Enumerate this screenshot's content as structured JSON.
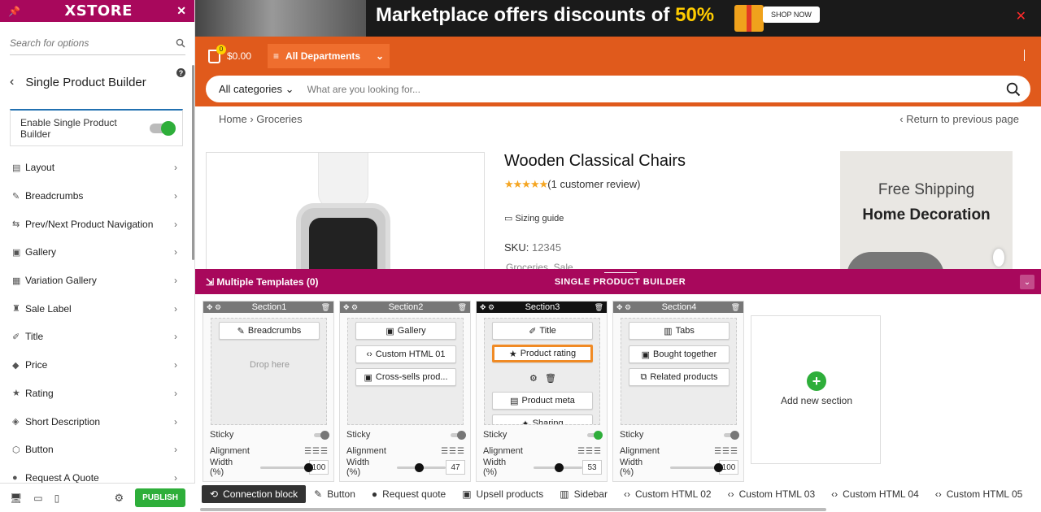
{
  "panel": {
    "logo": "XSTORE",
    "search_placeholder": "Search for options",
    "section_title": "Single Product Builder",
    "enable_label": "Enable Single Product Builder",
    "items": [
      {
        "label": "Layout",
        "icon": "layout-icon"
      },
      {
        "label": "Breadcrumbs",
        "icon": "breadcrumbs-icon"
      },
      {
        "label": "Prev/Next Product Navigation",
        "icon": "navigation-icon"
      },
      {
        "label": "Gallery",
        "icon": "gallery-icon"
      },
      {
        "label": "Variation Gallery",
        "icon": "variation-gallery-icon"
      },
      {
        "label": "Sale Label",
        "icon": "sale-label-icon"
      },
      {
        "label": "Title",
        "icon": "title-icon"
      },
      {
        "label": "Price",
        "icon": "price-icon"
      },
      {
        "label": "Rating",
        "icon": "star-icon"
      },
      {
        "label": "Short Description",
        "icon": "description-icon"
      },
      {
        "label": "Button",
        "icon": "button-icon"
      },
      {
        "label": "Request A Quote",
        "icon": "quote-icon"
      }
    ],
    "publish_label": "PUBLISH"
  },
  "site": {
    "banner_text": "Marketplace offers discounts of ",
    "banner_percent": "50%",
    "shop_now": "SHOP NOW",
    "cart_total": "$0.00",
    "cart_count": "0",
    "departments": "All Departments",
    "categories_select": "All categories",
    "search_placeholder": "What are you looking for...",
    "breadcrumb_home": "Home",
    "breadcrumb_current": "Groceries",
    "return_link": "Return to previous page",
    "product_title": "Wooden Classical Chairs",
    "rating_stars": "★★★★★",
    "review_text": "(1 customer review)",
    "sizing_guide": "Sizing guide",
    "sku_label": "SKU:",
    "sku_value": "12345",
    "categories": "Groceries, Sale",
    "ad_line1": "Free Shipping",
    "ad_line2": "Home Decoration"
  },
  "builder": {
    "multiple_templates": "Multiple Templates (0)",
    "title": "SINGLE PRODUCT BUILDER",
    "drop_here": "Drop here",
    "sticky_label": "Sticky",
    "alignment_label": "Alignment",
    "width_label": "Width (%)",
    "add_section": "Add new section",
    "sections": [
      {
        "name": "Section1",
        "width": "100",
        "width_fraction": 1.0,
        "sticky": false,
        "blocks": [
          "Breadcrumbs"
        ]
      },
      {
        "name": "Section2",
        "width": "47",
        "width_fraction": 0.47,
        "sticky": false,
        "blocks": [
          "Gallery",
          "Custom HTML 01",
          "Cross-sells prod..."
        ]
      },
      {
        "name": "Section3",
        "width": "53",
        "width_fraction": 0.53,
        "sticky": true,
        "blocks": [
          "Title",
          "Product rating",
          "Product meta",
          "Sharing"
        ]
      },
      {
        "name": "Section4",
        "width": "100",
        "width_fraction": 1.0,
        "sticky": false,
        "blocks": [
          "Tabs",
          "Bought together",
          "Related products"
        ]
      }
    ],
    "bottom_blocks": [
      "Connection block",
      "Button",
      "Request quote",
      "Upsell products",
      "Sidebar",
      "Custom HTML 02",
      "Custom HTML 03",
      "Custom HTML 04",
      "Custom HTML 05"
    ]
  },
  "colors": {
    "brand": "#a8085c",
    "orange": "#e05a1c",
    "green": "#2eae3a",
    "highlight": "#f08a24"
  }
}
